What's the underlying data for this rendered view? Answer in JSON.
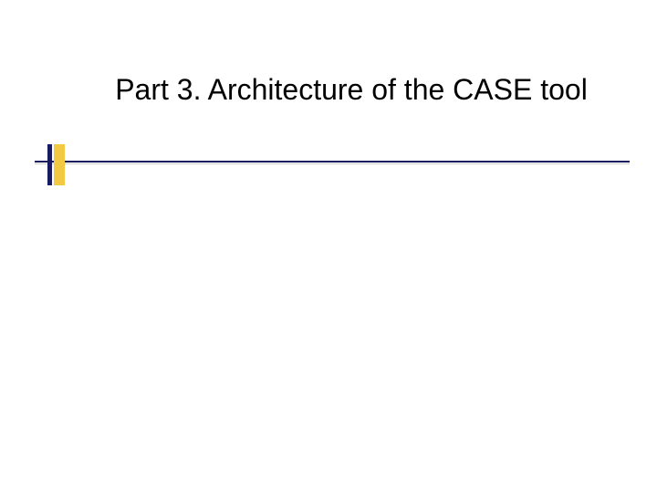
{
  "slide": {
    "title": "Part 3. Architecture of the CASE tool"
  },
  "theme": {
    "accent_navy": "#1a1a5e",
    "accent_yellow": "#f3c843"
  }
}
